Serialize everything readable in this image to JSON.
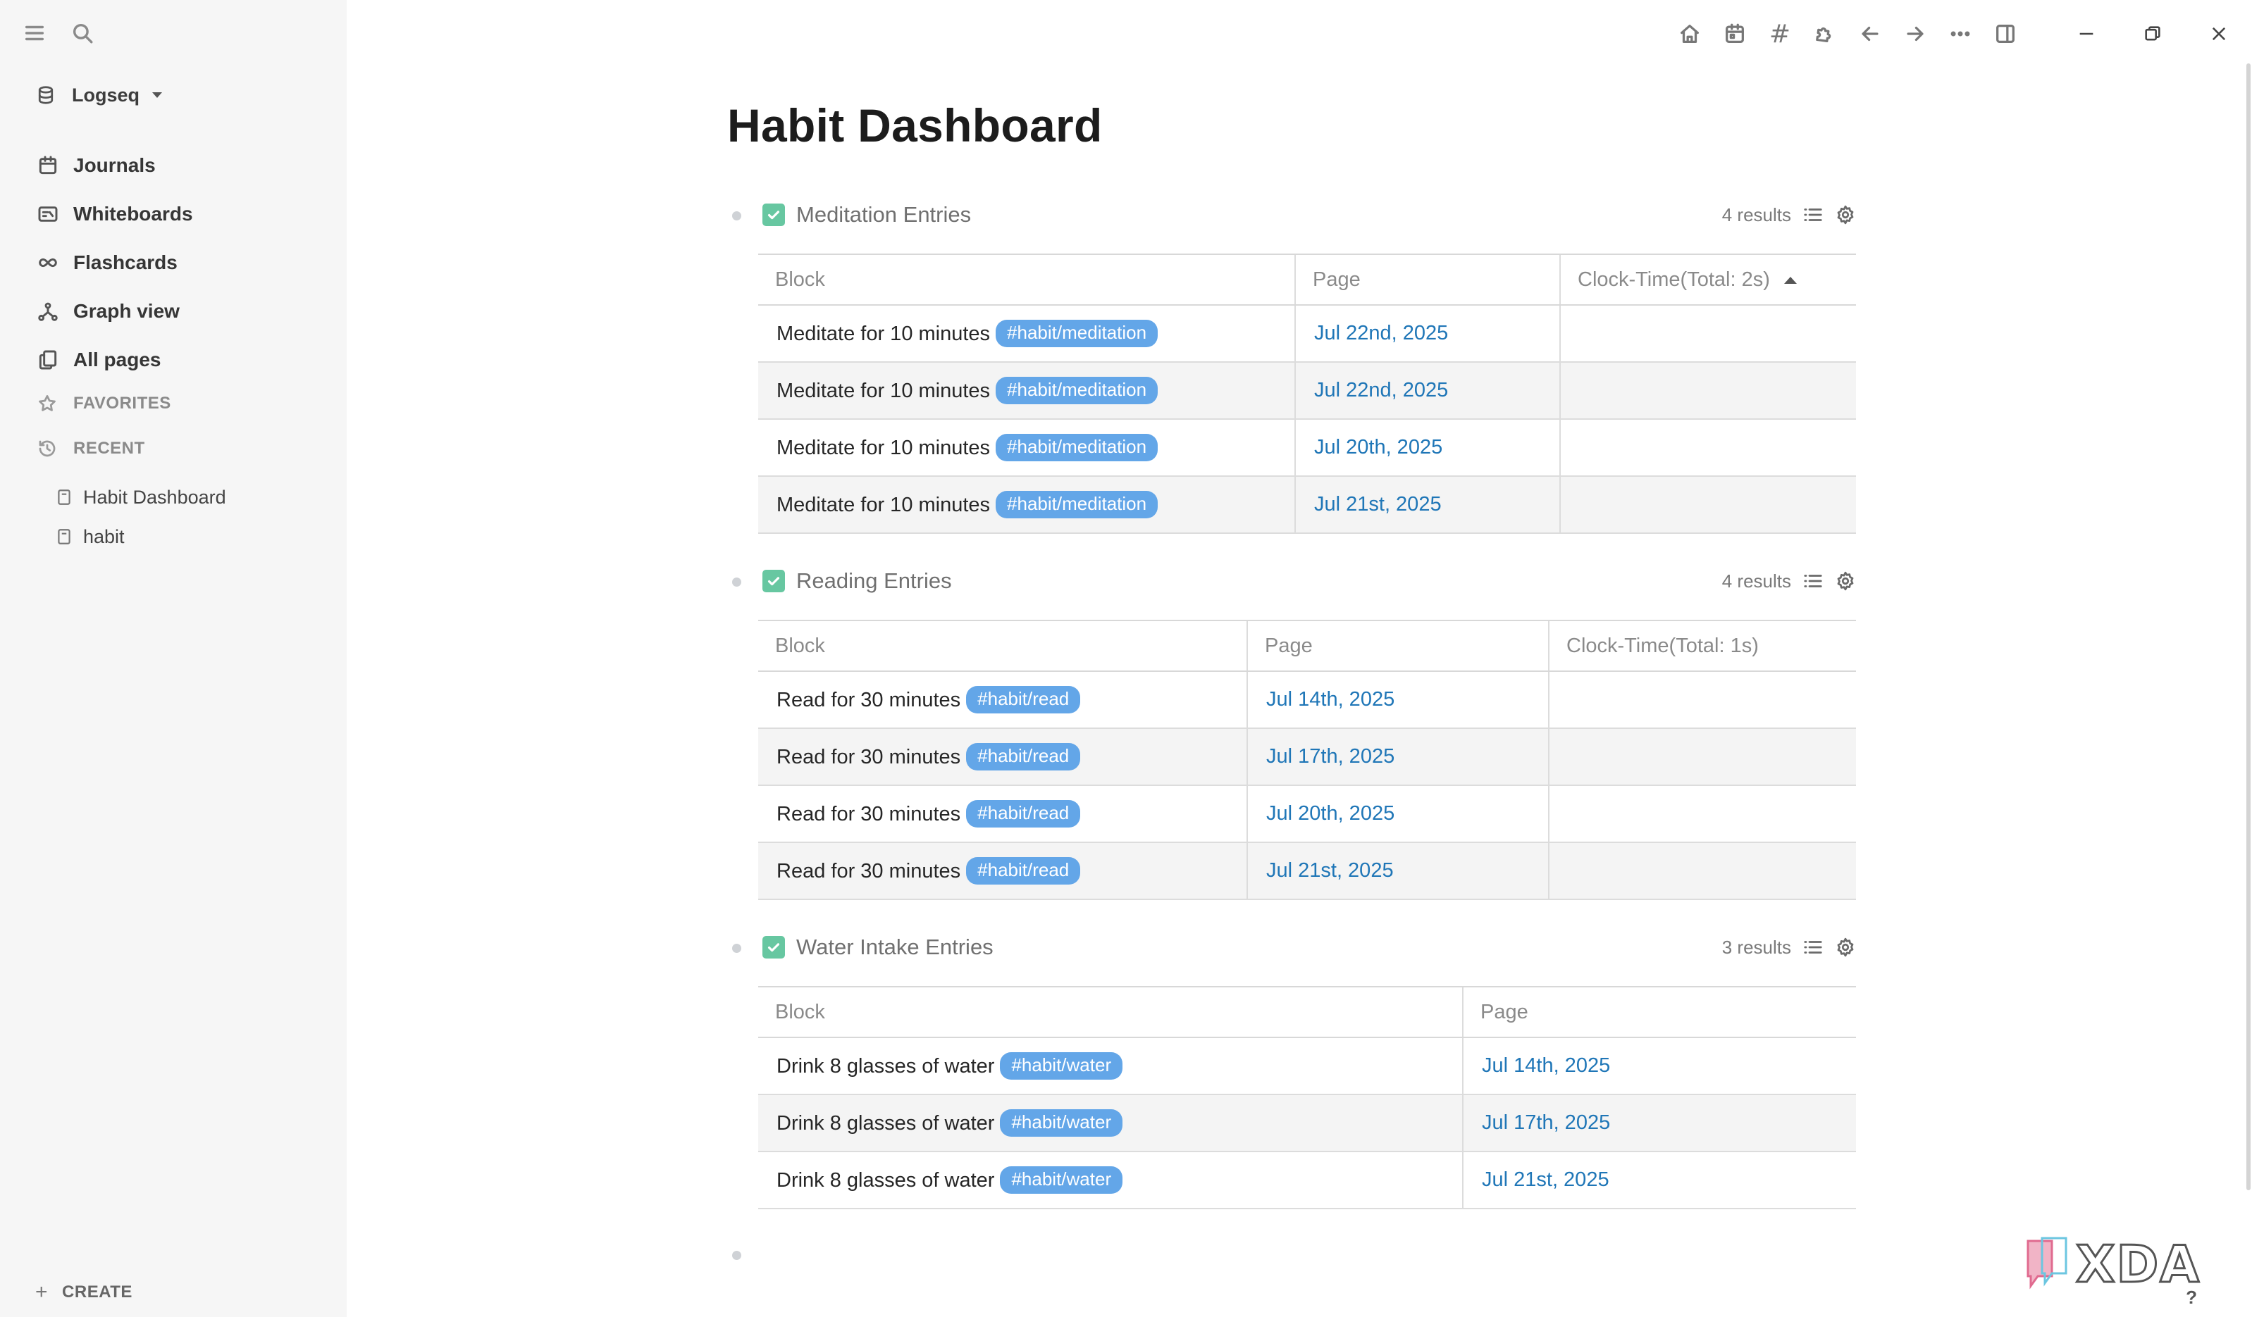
{
  "sidebar": {
    "repo_name": "Logseq",
    "nav": [
      {
        "label": "Journals",
        "icon": "calendar-icon"
      },
      {
        "label": "Whiteboards",
        "icon": "whiteboard-icon"
      },
      {
        "label": "Flashcards",
        "icon": "infinity-icon"
      },
      {
        "label": "Graph view",
        "icon": "graph-icon"
      },
      {
        "label": "All pages",
        "icon": "pages-icon"
      }
    ],
    "favorites_label": "FAVORITES",
    "recent_label": "RECENT",
    "recent": [
      "Habit Dashboard",
      "habit"
    ],
    "create_label": "CREATE"
  },
  "topbar": {
    "icons": [
      "home-icon",
      "calendar-icon",
      "hash-icon",
      "puzzle-icon",
      "arrow-left-icon",
      "arrow-right-icon",
      "more-icon",
      "sidebar-toggle-icon"
    ],
    "hash_glyph": "#"
  },
  "page": {
    "title": "Habit Dashboard"
  },
  "queries": {
    "meditation": {
      "title": "Meditation Entries",
      "results": "4 results",
      "columns": [
        "Block",
        "Page",
        "Clock-Time(Total: 2s)"
      ],
      "rows": [
        {
          "block": "Meditate for 10 minutes",
          "tag": "#habit/meditation",
          "page": "Jul 22nd, 2025"
        },
        {
          "block": "Meditate for 10 minutes",
          "tag": "#habit/meditation",
          "page": "Jul 22nd, 2025"
        },
        {
          "block": "Meditate for 10 minutes",
          "tag": "#habit/meditation",
          "page": "Jul 20th, 2025"
        },
        {
          "block": "Meditate for 10 minutes",
          "tag": "#habit/meditation",
          "page": "Jul 21st, 2025"
        }
      ]
    },
    "reading": {
      "title": "Reading Entries",
      "results": "4 results",
      "columns": [
        "Block",
        "Page",
        "Clock-Time(Total: 1s)"
      ],
      "rows": [
        {
          "block": "Read for 30 minutes",
          "tag": "#habit/read",
          "page": "Jul 14th, 2025"
        },
        {
          "block": "Read for 30 minutes",
          "tag": "#habit/read",
          "page": "Jul 17th, 2025"
        },
        {
          "block": "Read for 30 minutes",
          "tag": "#habit/read",
          "page": "Jul 20th, 2025"
        },
        {
          "block": "Read for 30 minutes",
          "tag": "#habit/read",
          "page": "Jul 21st, 2025"
        }
      ]
    },
    "water": {
      "title": "Water Intake Entries",
      "results": "3 results",
      "columns": [
        "Block",
        "Page"
      ],
      "rows": [
        {
          "block": "Drink 8 glasses of water",
          "tag": "#habit/water",
          "page": "Jul 14th, 2025"
        },
        {
          "block": "Drink 8 glasses of water",
          "tag": "#habit/water",
          "page": "Jul 17th, 2025"
        },
        {
          "block": "Drink 8 glasses of water",
          "tag": "#habit/water",
          "page": "Jul 21st, 2025"
        }
      ]
    }
  },
  "colors": {
    "accent_link": "#1f76b7",
    "tag_bg": "#63a6e8",
    "checkbox": "#67c7a1",
    "sidebar_bg": "#f6f6f6"
  },
  "watermark": "XDA",
  "help_glyph": "?"
}
